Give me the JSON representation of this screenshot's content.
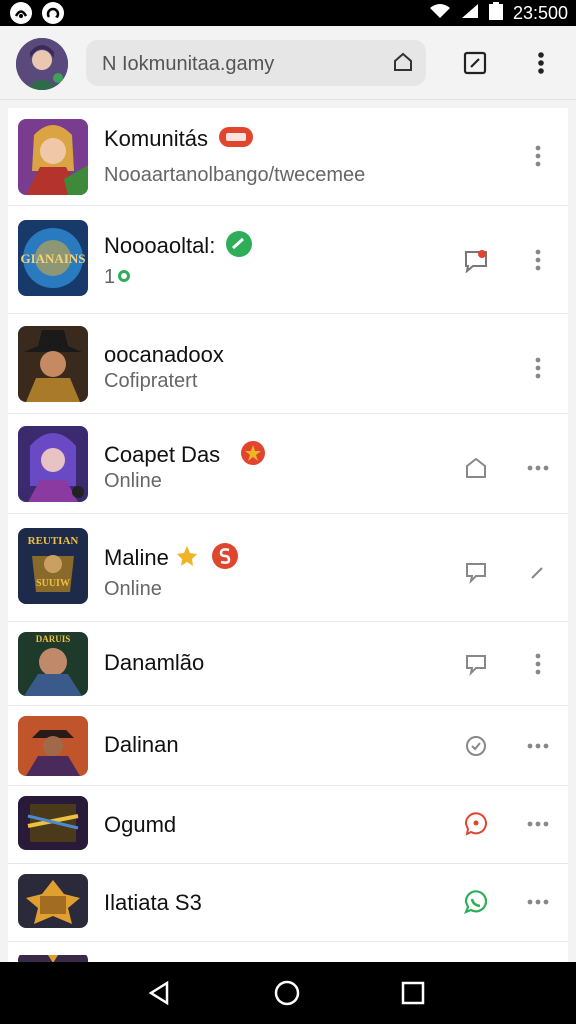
{
  "status": {
    "time": "23:500",
    "battery_icon": "battery-icon",
    "signal_icon": "signal-icon",
    "wifi_icon": "wifi-icon"
  },
  "search": {
    "text": "N Iokmunitaa.gamy"
  },
  "items": [
    {
      "title": "Komunitás",
      "sub": "Nooaartanolbango/twecemee",
      "badge": "red-pill-badge"
    },
    {
      "title": "Noooaoltal:",
      "sub": "1",
      "badge": "green-check-badge"
    },
    {
      "title": "oocanadoox",
      "sub": "Cofipratert"
    },
    {
      "title": "Coapet Das",
      "sub": "Online",
      "badge": "red-star-badge"
    },
    {
      "title": "Maline",
      "sub": "Online",
      "badge": "gold-crown-badge"
    },
    {
      "title": "Danamlão",
      "sub": ""
    },
    {
      "title": "Dalinan",
      "sub": ""
    },
    {
      "title": "Ogumd",
      "sub": ""
    },
    {
      "title": "Ilatiata S3",
      "sub": ""
    }
  ],
  "thumb_text": {
    "t2": "GIANAINS",
    "t5a": "REUTIAN",
    "t5b": "SUUIW",
    "t8": "DARUIS"
  },
  "colors": {
    "red": "#e0452e",
    "green": "#2fae5a",
    "gold": "#f0b429"
  }
}
